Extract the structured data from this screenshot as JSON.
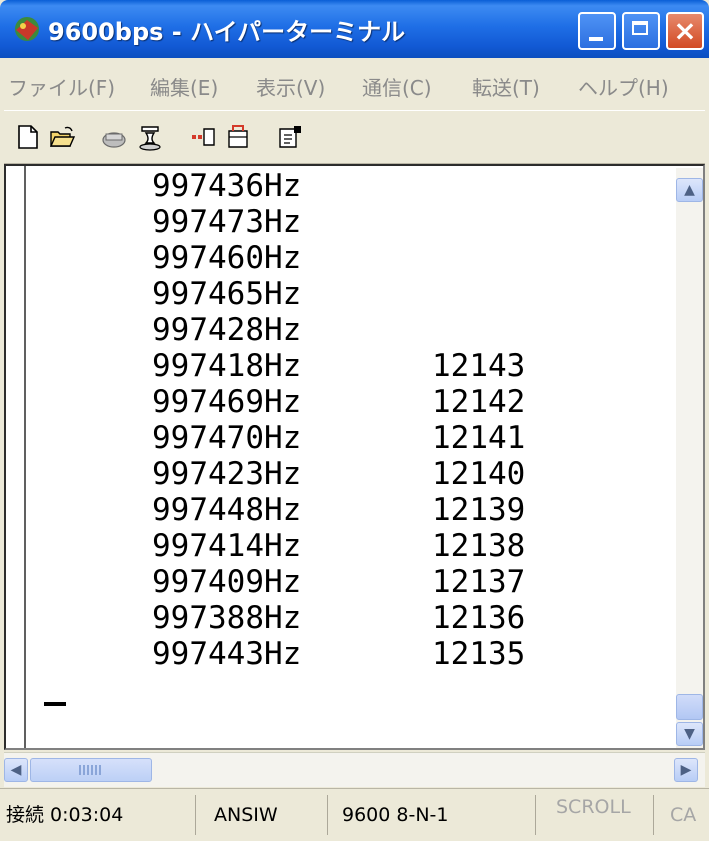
{
  "window": {
    "title": "9600bps - ハイパーターミナル"
  },
  "menu": [
    {
      "label": "ファイル(F)"
    },
    {
      "label": "編集(E)"
    },
    {
      "label": "表示(V)"
    },
    {
      "label": "通信(C)"
    },
    {
      "label": "転送(T)"
    },
    {
      "label": "ヘルプ(H)"
    }
  ],
  "toolbar": {
    "icons": [
      "new-document-icon",
      "open-folder-icon",
      "phone-dial-icon",
      "disconnect-icon",
      "send-icon",
      "receive-icon",
      "properties-icon"
    ]
  },
  "terminal": {
    "lines": [
      {
        "freq": "997436Hz",
        "count": ""
      },
      {
        "freq": "997473Hz",
        "count": ""
      },
      {
        "freq": "997460Hz",
        "count": ""
      },
      {
        "freq": "997465Hz",
        "count": ""
      },
      {
        "freq": "997428Hz",
        "count": ""
      },
      {
        "freq": "997418Hz",
        "count": "12143"
      },
      {
        "freq": "997469Hz",
        "count": "12142"
      },
      {
        "freq": "997470Hz",
        "count": "12141"
      },
      {
        "freq": "997423Hz",
        "count": "12140"
      },
      {
        "freq": "997448Hz",
        "count": "12139"
      },
      {
        "freq": "997414Hz",
        "count": "12138"
      },
      {
        "freq": "997409Hz",
        "count": "12137"
      },
      {
        "freq": "997388Hz",
        "count": "12136"
      },
      {
        "freq": "997443Hz",
        "count": "12135"
      }
    ]
  },
  "scrollbars": {
    "h_grip": "IIII"
  },
  "status": {
    "connection": "接続 0:03:04",
    "emulation": "ANSIW",
    "port": "9600 8-N-1",
    "scroll": "SCROLL",
    "caps": "CA"
  }
}
